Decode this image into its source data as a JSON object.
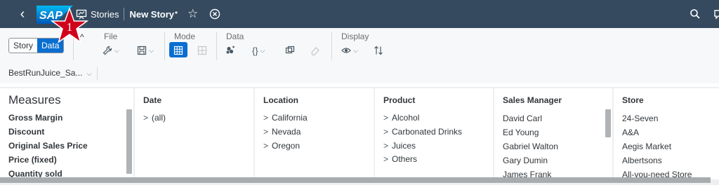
{
  "shell": {
    "logo_text": "SAP",
    "breadcrumb_stories": "Stories",
    "document_name": "New Story",
    "unsaved_mark": "*",
    "star_glyph": "☆",
    "back_glyph": "‹",
    "icons": [
      "back-icon",
      "story-icon",
      "star-icon",
      "close-circle-icon",
      "search-icon",
      "chat-icon"
    ]
  },
  "toolbar": {
    "view_toggle": {
      "story_label": "Story",
      "data_label": "Data",
      "selected": "Data"
    },
    "collapse_glyph": "^",
    "groups": {
      "file": "File",
      "mode": "Mode",
      "data": "Data",
      "display": "Display"
    },
    "data_braces": "{}",
    "dropdown_glyph": "⌵"
  },
  "model": {
    "name": "BestRunJuice_Sa...",
    "dropdown_glyph": "⌵"
  },
  "marker": {
    "number": "1",
    "color": "#d0021b"
  },
  "panels": {
    "measures": {
      "title": "Measures",
      "items": [
        "Gross Margin",
        "Discount",
        "Original Sales Price",
        "Price (fixed)",
        "Quantity sold"
      ]
    },
    "date": {
      "title": "Date",
      "items": [
        "(all)"
      ]
    },
    "location": {
      "title": "Location",
      "items": [
        "California",
        "Nevada",
        "Oregon"
      ]
    },
    "product": {
      "title": "Product",
      "items": [
        "Alcohol",
        "Carbonated Drinks",
        "Juices",
        "Others"
      ]
    },
    "sales_manager": {
      "title": "Sales Manager",
      "items": [
        "David Carl",
        "Ed Young",
        "Gabriel Walton",
        "Gary Dumin",
        "James Frank"
      ]
    },
    "store": {
      "title": "Store",
      "items": [
        "24-Seven",
        "A&A",
        "Aegis Market",
        "Albertsons",
        "All-you-need Store"
      ]
    }
  },
  "chevron_glyph": ">",
  "colors": {
    "shell": "#354a5f",
    "accent": "#0a6ed1",
    "marker": "#d0021b"
  }
}
